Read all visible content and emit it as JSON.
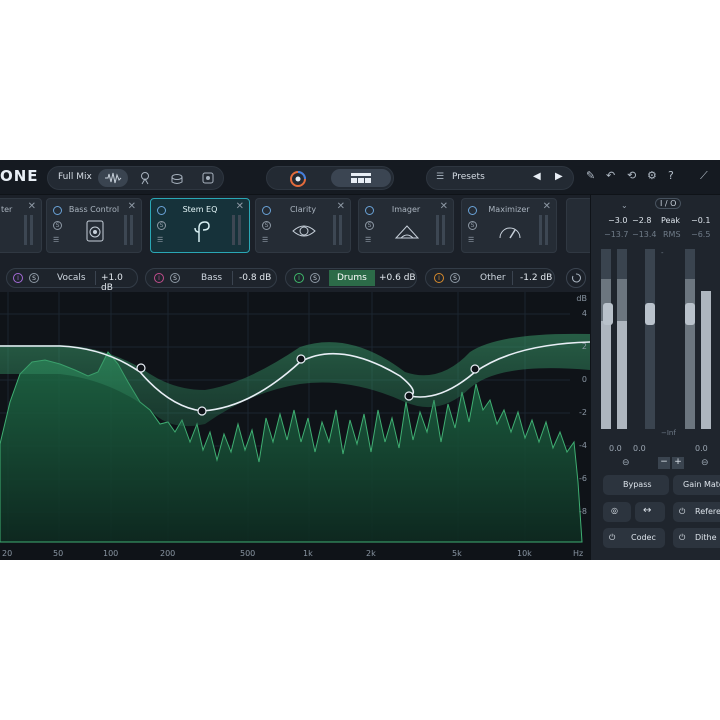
{
  "app": {
    "brand": "ONE",
    "brand_sub": ""
  },
  "topbar": {
    "mix_label": "Full Mix",
    "presets_label": "Presets"
  },
  "modules": [
    {
      "name": "ter"
    },
    {
      "name": "Bass Control"
    },
    {
      "name": "Stem EQ"
    },
    {
      "name": "Clarity"
    },
    {
      "name": "Imager"
    },
    {
      "name": "Maximizer"
    }
  ],
  "stems": [
    {
      "name": "Vocals",
      "gain": "+1.0 dB",
      "color": "#a56ad8"
    },
    {
      "name": "Bass",
      "gain": "-0.8 dB",
      "color": "#c04d8c"
    },
    {
      "name": "Drums",
      "gain": "+0.6 dB",
      "color": "#3fb86a"
    },
    {
      "name": "Other",
      "gain": "-1.2 dB",
      "color": "#d68a2c"
    }
  ],
  "eq": {
    "db_unit": "dB",
    "db_ticks": [
      "4",
      "2",
      "0",
      "-2",
      "-4",
      "-6",
      "-8"
    ],
    "hz_ticks": [
      "20",
      "50",
      "100",
      "200",
      "500",
      "1k",
      "2k",
      "5k",
      "10k",
      "Hz"
    ]
  },
  "meters": {
    "in_peak_l": "−3.0",
    "in_peak_r": "−2.8",
    "in_rms_l": "−13.7",
    "in_rms_r": "−13.4",
    "peak_label": "Peak",
    "rms_label": "RMS",
    "out_peak": "−0.1",
    "out_rms": "−6.5",
    "io_label": "I / O",
    "scale_inf": "−Inf",
    "zero_l1": "0.0",
    "zero_l2": "0.0",
    "zero_r1": "0.0",
    "bypass_label": "Bypass",
    "gain_match_label": "Gain Match",
    "codec_label": "Codec",
    "reference_label": "Refere",
    "dither_label": "Dithe"
  }
}
